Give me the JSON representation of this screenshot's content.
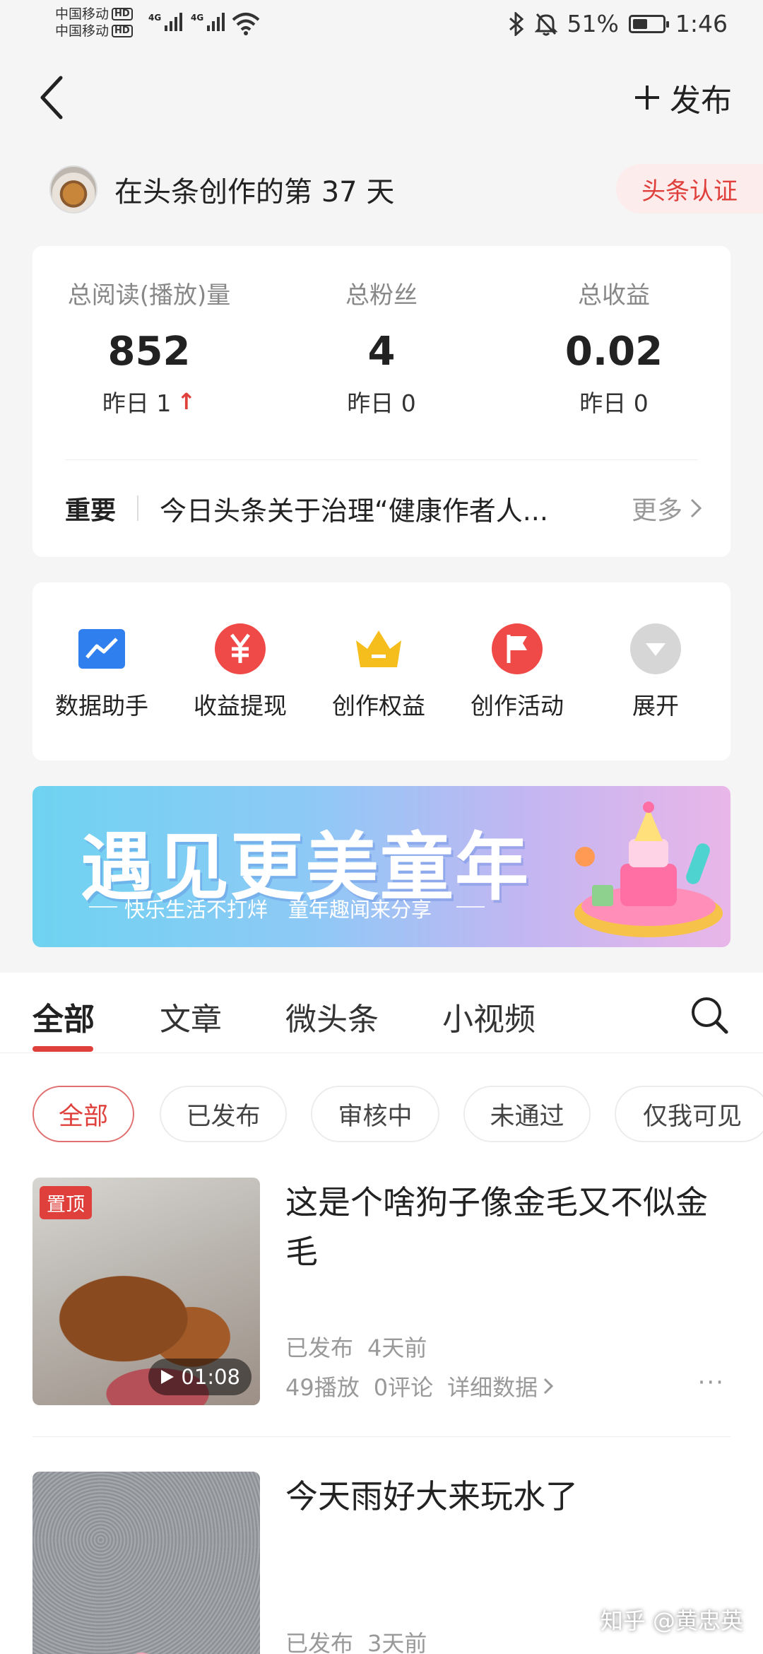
{
  "status_bar": {
    "carrier1": "中国移动",
    "carrier2": "中国移动",
    "hd": "HD",
    "network": "4G",
    "battery_percent": "51%",
    "battery_level": 0.51,
    "time": "1:46"
  },
  "header": {
    "publish_label": "发布"
  },
  "creator": {
    "days_text": "在头条创作的第 37 天",
    "cert_label": "头条认证"
  },
  "stats": [
    {
      "label": "总阅读(播放)量",
      "value": "852",
      "yesterday": "昨日 1",
      "trend": "up"
    },
    {
      "label": "总粉丝",
      "value": "4",
      "yesterday": "昨日 0"
    },
    {
      "label": "总收益",
      "value": "0.02",
      "yesterday": "昨日 0"
    }
  ],
  "notice": {
    "tag": "重要",
    "message": "今日头条关于治理“健康作者人...",
    "more": "更多"
  },
  "tools": [
    {
      "label": "数据助手",
      "icon": "chart-icon",
      "color": "#2f7fef"
    },
    {
      "label": "收益提现",
      "icon": "yuan-icon",
      "color": "#f04a48"
    },
    {
      "label": "创作权益",
      "icon": "crown-icon",
      "color": "#f5be1c"
    },
    {
      "label": "创作活动",
      "icon": "flag-icon",
      "color": "#f04a48"
    },
    {
      "label": "展开",
      "icon": "expand-icon",
      "color": "#d6d6d6"
    }
  ],
  "banner": {
    "title": "遇见更美童年",
    "subtitle": "快乐生活不打烊　童年趣闻来分享"
  },
  "tabs": [
    "全部",
    "文章",
    "微头条",
    "小视频"
  ],
  "filters": [
    "全部",
    "已发布",
    "审核中",
    "未通过",
    "仅我可见"
  ],
  "posts": [
    {
      "title": "这是个啥狗子像金毛又不似金毛",
      "pin": "置顶",
      "duration": "01:08",
      "status": "已发布",
      "time": "4天前",
      "plays": "49播放",
      "comments": "0评论",
      "details": "详细数据",
      "more": "···"
    },
    {
      "title": "今天雨好大来玩水了",
      "status": "已发布",
      "time": "3天前"
    }
  ],
  "watermark": "知乎 @黄忠英"
}
